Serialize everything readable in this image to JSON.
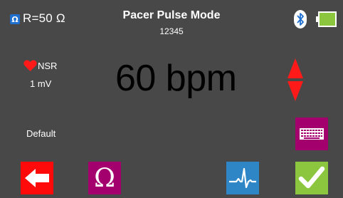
{
  "header": {
    "resistance_badge": "Ω",
    "resistance": "R=50 Ω",
    "title": "Pacer Pulse Mode",
    "serial": "12345"
  },
  "status": {
    "bluetooth_icon": "bluetooth-icon",
    "battery_icon": "battery-icon",
    "battery_color": "#8cc63f"
  },
  "signal": {
    "rhythm": "NSR",
    "amplitude": "1 mV",
    "preset": "Default"
  },
  "rate": {
    "value": "60 bpm"
  },
  "buttons": {
    "omega_label": "Ω",
    "back_color": "#ff0a0a",
    "omega_color": "#a3006e",
    "keyboard_color": "#a3006e",
    "ecg_color": "#2f86c6",
    "ok_color": "#8cc63f"
  }
}
